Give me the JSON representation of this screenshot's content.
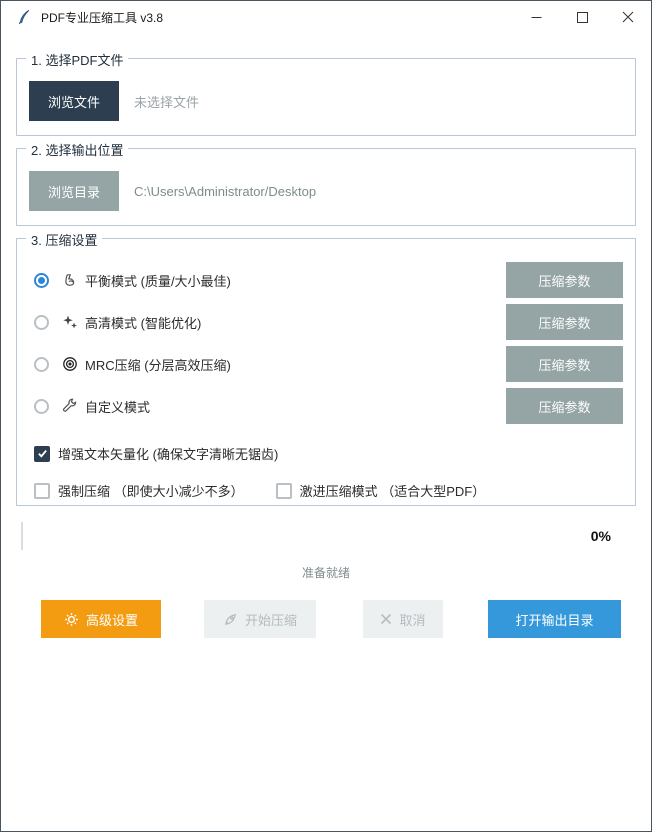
{
  "window": {
    "title": "PDF专业压缩工具 v3.8",
    "icons": {
      "app": "feather-icon",
      "minimize": "minimize-icon",
      "maximize": "maximize-icon",
      "close": "close-icon"
    }
  },
  "sections": {
    "file": {
      "title": "1. 选择PDF文件",
      "browse_button": "浏览文件",
      "status": "未选择文件"
    },
    "output": {
      "title": "2. 选择输出位置",
      "browse_button": "浏览目录",
      "path": "C:\\Users\\Administrator/Desktop"
    },
    "settings": {
      "title": "3. 压缩设置",
      "modes": [
        {
          "label": "平衡模式 (质量/大小最佳)",
          "icon": "muscle-icon",
          "selected": true,
          "param_button": "压缩参数"
        },
        {
          "label": "高清模式 (智能优化)",
          "icon": "sparkles-icon",
          "selected": false,
          "param_button": "压缩参数"
        },
        {
          "label": "MRC压缩 (分层高效压缩)",
          "icon": "target-icon",
          "selected": false,
          "param_button": "压缩参数"
        },
        {
          "label": "自定义模式",
          "icon": "wrench-icon",
          "selected": false,
          "param_button": "压缩参数"
        }
      ],
      "checkboxes": [
        {
          "label": "增强文本矢量化 (确保文字清晰无锯齿)",
          "checked": true
        },
        {
          "label": "强制压缩 （即使大小减少不多）",
          "checked": false
        },
        {
          "label": "激进压缩模式 （适合大型PDF）",
          "checked": false
        }
      ]
    }
  },
  "progress": {
    "percent": "0%",
    "status": "准备就绪"
  },
  "actions": {
    "advanced": "高级设置",
    "start": "开始压缩",
    "cancel": "取消",
    "open_output": "打开输出目录"
  },
  "colors": {
    "primary_dark": "#2c3e50",
    "secondary_gray": "#95a5a6",
    "accent_orange": "#f39c12",
    "accent_blue": "#3498db",
    "radio_blue": "#2e86d9",
    "group_border": "#b8c6d8"
  }
}
